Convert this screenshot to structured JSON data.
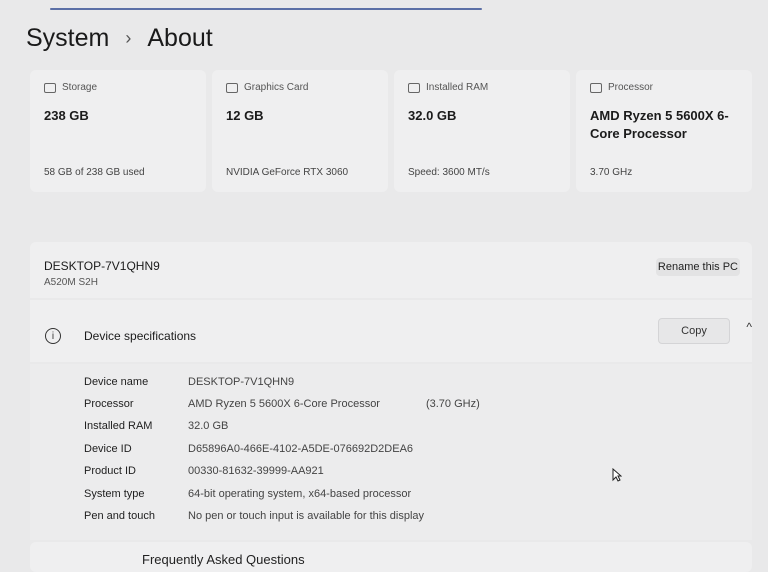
{
  "breadcrumb": {
    "root": "System",
    "separator": "›",
    "current": "About"
  },
  "cards": [
    {
      "icon": "storage-icon",
      "label": "Storage",
      "value": "238 GB",
      "sub": "58 GB of 238 GB used"
    },
    {
      "icon": "graphics-card-icon",
      "label": "Graphics Card",
      "value": "12 GB",
      "sub": "NVIDIA GeForce RTX 3060"
    },
    {
      "icon": "ram-icon",
      "label": "Installed RAM",
      "value": "32.0 GB",
      "sub": "Speed: 3600 MT/s"
    },
    {
      "icon": "processor-icon",
      "label": "Processor",
      "value": "AMD Ryzen 5 5600X 6-Core Processor",
      "sub": "3.70 GHz"
    }
  ],
  "pc": {
    "name": "DESKTOP-7V1QHN9",
    "model": "A520M S2H",
    "rename_label": "Rename this PC"
  },
  "specs_section": {
    "title": "Device specifications",
    "copy_label": "Copy",
    "collapse_glyph": "^"
  },
  "specs": [
    {
      "label": "Device name",
      "value": "DESKTOP-7V1QHN9"
    },
    {
      "label": "Processor",
      "value": "AMD Ryzen 5 5600X 6-Core Processor",
      "extra": "(3.70 GHz)"
    },
    {
      "label": "Installed RAM",
      "value": "32.0 GB"
    },
    {
      "label": "Device ID",
      "value": "D65896A0-466E-4102-A5DE-076692D2DEA6"
    },
    {
      "label": "Product ID",
      "value": "00330-81632-39999-AA921"
    },
    {
      "label": "System type",
      "value": "64-bit operating system, x64-based processor"
    },
    {
      "label": "Pen and touch",
      "value": "No pen or touch input is available for this display"
    }
  ],
  "faq": {
    "title": "Frequently Asked Questions"
  }
}
